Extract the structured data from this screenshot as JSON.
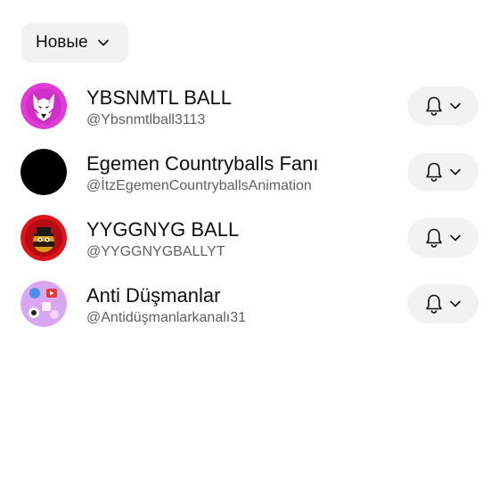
{
  "sort": {
    "label": "Новые"
  },
  "channels": [
    {
      "name": "YBSNMTL BALL",
      "handle": "@Ybsnmtlball3113",
      "avatar": "wolf-logo-pink"
    },
    {
      "name": "Egemen Countryballs Fanı",
      "handle": "@İtzEgemenCountryballsAnimation",
      "avatar": "black-circle"
    },
    {
      "name": "YYGGNYG BALL",
      "handle": "@YYGGNYGBALLYT",
      "avatar": "red-countryball"
    },
    {
      "name": "Anti Düşmanlar",
      "handle": "@Antidüşmanlarkanalı31",
      "avatar": "app-icons-collage"
    }
  ],
  "icons": {
    "bell": "bell-icon",
    "chevron": "chevron-down-icon"
  },
  "colors": {
    "chip_bg": "#f2f2f2",
    "handle_text": "#606060"
  }
}
